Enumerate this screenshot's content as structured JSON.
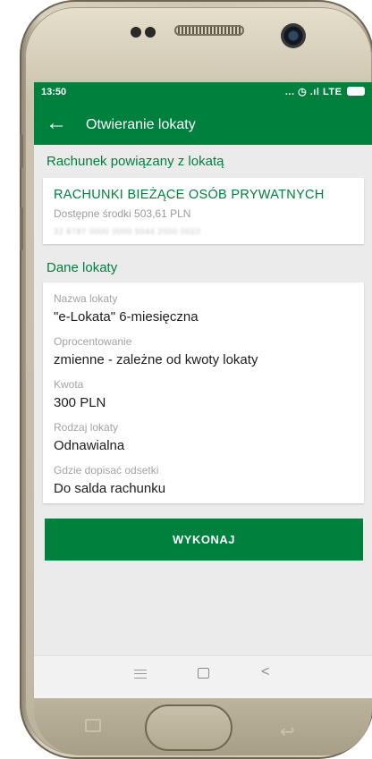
{
  "status_bar": {
    "time": "13:50",
    "indicators": "... ◷ .ıl LTE",
    "icons": [
      "alarm-icon",
      "signal-icon",
      "battery-icon"
    ]
  },
  "app_bar": {
    "back_icon": "arrow-left-icon",
    "back_glyph": "←",
    "title": "Otwieranie lokaty"
  },
  "linked_account": {
    "section_title": "Rachunek powiązany z lokatą",
    "name": "RACHUNKI BIEŻĄCE OSÓB PRYWATNYCH",
    "available_funds": "Dostępne środki 503,61 PLN",
    "account_number": "32 8787 0000 0000 5044 2000 0010"
  },
  "deposit_details": {
    "section_title": "Dane lokaty",
    "fields": [
      {
        "label": "Nazwa lokaty",
        "value": "\"e-Lokata\" 6-miesięczna"
      },
      {
        "label": "Oprocentowanie",
        "value": "zmienne - zależne od kwoty lokaty"
      },
      {
        "label": "Kwota",
        "value": "300 PLN"
      },
      {
        "label": "Rodzaj lokaty",
        "value": "Odnawialna"
      },
      {
        "label": "Gdzie dopisać odsetki",
        "value": "Do salda rachunku"
      }
    ]
  },
  "actions": {
    "execute_label": "WYKONAJ"
  },
  "system_nav": {
    "menu_icon": "menu-icon",
    "home_icon": "home-square-icon",
    "back_icon": "chevron-left-icon",
    "back_glyph": "<"
  },
  "colors": {
    "brand_green": "#00803d",
    "screen_background": "#ebebeb",
    "card_background": "#ffffff",
    "label_gray": "#a3a3a3"
  }
}
